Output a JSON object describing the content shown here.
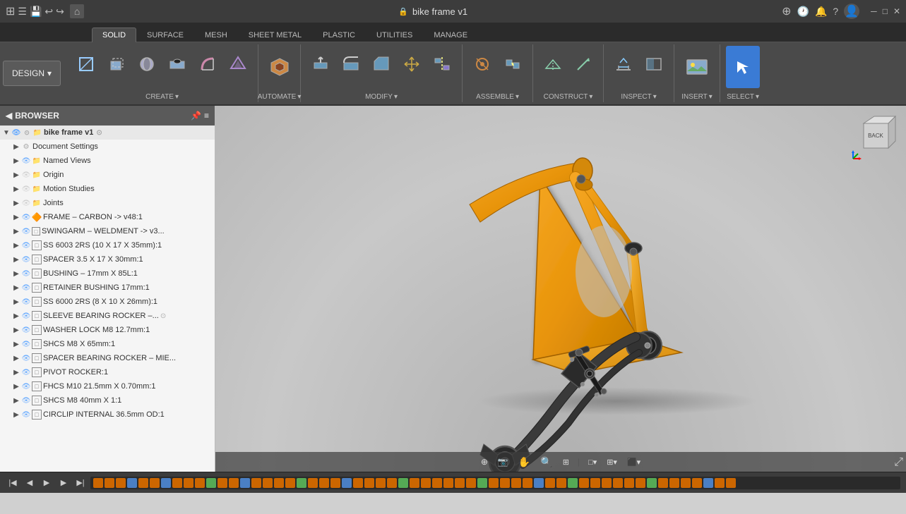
{
  "titlebar": {
    "title": "bike frame v1",
    "lock_icon": "🔒",
    "close_btn": "✕",
    "new_tab_btn": "+",
    "icons_right": [
      "⊕",
      "🕐",
      "🔔",
      "?",
      "👤"
    ]
  },
  "ribbon": {
    "tabs": [
      "SOLID",
      "SURFACE",
      "MESH",
      "SHEET METAL",
      "PLASTIC",
      "UTILITIES",
      "MANAGE"
    ],
    "active_tab": "SOLID",
    "design_btn": "DESIGN ▾",
    "groups": {
      "create": {
        "label": "CREATE ▾",
        "buttons": [
          "⬜",
          "⬛",
          "⬤",
          "⬜",
          "✦",
          "⬡"
        ]
      },
      "automate": {
        "label": "AUTOMATE ▾",
        "buttons": [
          "⚙"
        ]
      },
      "modify": {
        "label": "MODIFY ▾",
        "buttons": [
          "⬜",
          "⬜",
          "⬛",
          "⬛",
          "✦"
        ]
      },
      "assemble": {
        "label": "ASSEMBLE ▾",
        "buttons": [
          "⚙",
          "◉"
        ]
      },
      "construct": {
        "label": "CONSTRUCT ▾",
        "buttons": [
          "⊞",
          "⊟"
        ]
      },
      "inspect": {
        "label": "INSPECT ▾",
        "buttons": [
          "📐",
          "⬜"
        ]
      },
      "insert": {
        "label": "INSERT ▾",
        "buttons": [
          "🖼"
        ]
      },
      "select": {
        "label": "SELECT ▾",
        "buttons": [
          "⬜"
        ]
      }
    }
  },
  "browser": {
    "header": "BROWSER",
    "root_item": "bike frame v1",
    "items": [
      {
        "label": "Document Settings",
        "icon": "⚙",
        "indent": 2,
        "has_arrow": true
      },
      {
        "label": "Named Views",
        "icon": "📁",
        "indent": 2,
        "has_arrow": true
      },
      {
        "label": "Origin",
        "icon": "📁",
        "indent": 2,
        "has_arrow": true
      },
      {
        "label": "Motion Studies",
        "icon": "📁",
        "indent": 2,
        "has_arrow": true
      },
      {
        "label": "Joints",
        "icon": "📁",
        "indent": 2,
        "has_arrow": true
      },
      {
        "label": "FRAME – CARBON -> v48:1",
        "icon": "🔶",
        "indent": 2,
        "has_arrow": true
      },
      {
        "label": "SWINGARM – WELDMENT -> v3...",
        "icon": "⬜",
        "indent": 2,
        "has_arrow": true
      },
      {
        "label": "SS 6003 2RS (10 X 17 X 35mm):1",
        "icon": "⬜",
        "indent": 2,
        "has_arrow": true
      },
      {
        "label": "SPACER 3.5 X 17 X 30mm:1",
        "icon": "⬜",
        "indent": 2,
        "has_arrow": true
      },
      {
        "label": "BUSHING – 17mm X 85L:1",
        "icon": "⬜",
        "indent": 2,
        "has_arrow": true
      },
      {
        "label": "RETAINER BUSHING 17mm:1",
        "icon": "⬜",
        "indent": 2,
        "has_arrow": true
      },
      {
        "label": "SS 6000 2RS (8 X 10 X 26mm):1",
        "icon": "⬜",
        "indent": 2,
        "has_arrow": true
      },
      {
        "label": "SLEEVE BEARING ROCKER –...",
        "icon": "⬜",
        "indent": 2,
        "has_arrow": true,
        "has_dot": true
      },
      {
        "label": "WASHER LOCK M8 12.7mm:1",
        "icon": "⬜",
        "indent": 2,
        "has_arrow": true
      },
      {
        "label": "SHCS M8 X 65mm:1",
        "icon": "⬜",
        "indent": 2,
        "has_arrow": true
      },
      {
        "label": "SPACER BEARING ROCKER – MIE...",
        "icon": "⬜",
        "indent": 2,
        "has_arrow": true
      },
      {
        "label": "PIVOT ROCKER:1",
        "icon": "⬜",
        "indent": 2,
        "has_arrow": true
      },
      {
        "label": "FHCS M10 21.5mm X 0.70mm:1",
        "icon": "⬜",
        "indent": 2,
        "has_arrow": true
      },
      {
        "label": "SHCS M8 40mm X 1:1",
        "icon": "⬜",
        "indent": 2,
        "has_arrow": true
      },
      {
        "label": "CIRCLIP INTERNAL 36.5mm OD:1",
        "icon": "⬜",
        "indent": 2,
        "has_arrow": true
      }
    ]
  },
  "viewport": {
    "viewcube_labels": [
      "BACK"
    ]
  },
  "viewport_toolbar": {
    "buttons": [
      "⊕⊖",
      "📷",
      "✋",
      "🔍",
      "🔍+",
      "□",
      "⊞",
      "⬛"
    ]
  },
  "timeline": {
    "prev_btn": "◀◀",
    "rewind_btn": "◀",
    "play_btn": "▶",
    "forward_btn": "▶▶",
    "end_btn": "▶|"
  }
}
